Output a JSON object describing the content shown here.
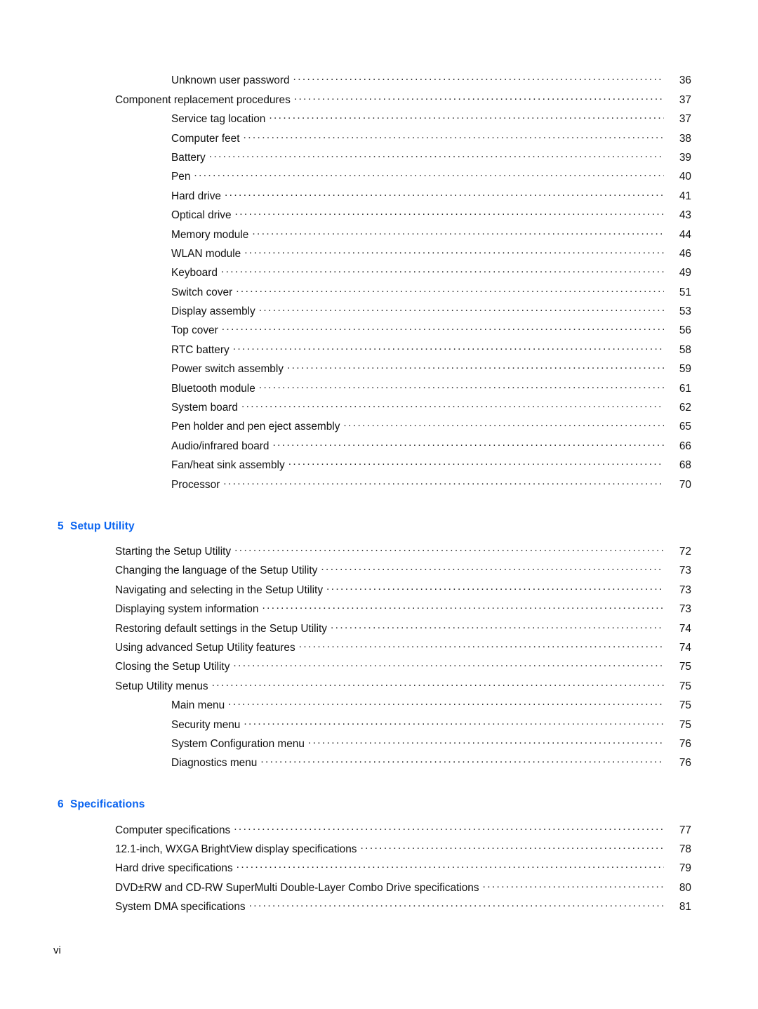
{
  "page": {
    "folio": "vi",
    "accent_color": "#0A64F0",
    "text_color": "#111111",
    "background_color": "#FFFFFF"
  },
  "toc": {
    "blocks": [
      {
        "chapter": null,
        "entries": [
          {
            "label": "Unknown user password",
            "page": "36",
            "level": 2
          },
          {
            "label": "Component replacement procedures",
            "page": "37",
            "level": 1
          },
          {
            "label": "Service tag location",
            "page": "37",
            "level": 2
          },
          {
            "label": "Computer feet",
            "page": "38",
            "level": 2
          },
          {
            "label": "Battery",
            "page": "39",
            "level": 2
          },
          {
            "label": "Pen",
            "page": "40",
            "level": 2
          },
          {
            "label": "Hard drive",
            "page": "41",
            "level": 2
          },
          {
            "label": "Optical drive",
            "page": "43",
            "level": 2
          },
          {
            "label": "Memory module",
            "page": "44",
            "level": 2
          },
          {
            "label": "WLAN module",
            "page": "46",
            "level": 2
          },
          {
            "label": "Keyboard",
            "page": "49",
            "level": 2
          },
          {
            "label": "Switch cover",
            "page": "51",
            "level": 2
          },
          {
            "label": "Display assembly",
            "page": "53",
            "level": 2
          },
          {
            "label": "Top cover",
            "page": "56",
            "level": 2
          },
          {
            "label": "RTC battery",
            "page": "58",
            "level": 2
          },
          {
            "label": "Power switch assembly",
            "page": "59",
            "level": 2
          },
          {
            "label": "Bluetooth module",
            "page": "61",
            "level": 2
          },
          {
            "label": "System board",
            "page": "62",
            "level": 2
          },
          {
            "label": "Pen holder and pen eject assembly",
            "page": "65",
            "level": 2
          },
          {
            "label": "Audio/infrared board",
            "page": "66",
            "level": 2
          },
          {
            "label": "Fan/heat sink assembly",
            "page": "68",
            "level": 2
          },
          {
            "label": "Processor",
            "page": "70",
            "level": 2
          }
        ]
      },
      {
        "chapter": {
          "number": "5",
          "title": "Setup Utility"
        },
        "entries": [
          {
            "label": "Starting the Setup Utility",
            "page": "72",
            "level": 1
          },
          {
            "label": "Changing the language of the Setup Utility",
            "page": "73",
            "level": 1
          },
          {
            "label": "Navigating and selecting in the Setup Utility",
            "page": "73",
            "level": 1
          },
          {
            "label": "Displaying system information",
            "page": "73",
            "level": 1
          },
          {
            "label": "Restoring default settings in the Setup Utility",
            "page": "74",
            "level": 1
          },
          {
            "label": "Using advanced Setup Utility features",
            "page": "74",
            "level": 1
          },
          {
            "label": "Closing the Setup Utility",
            "page": "75",
            "level": 1
          },
          {
            "label": "Setup Utility menus",
            "page": "75",
            "level": 1
          },
          {
            "label": "Main menu",
            "page": "75",
            "level": 2
          },
          {
            "label": "Security menu",
            "page": "75",
            "level": 2
          },
          {
            "label": "System Configuration menu",
            "page": "76",
            "level": 2
          },
          {
            "label": "Diagnostics menu",
            "page": "76",
            "level": 2
          }
        ]
      },
      {
        "chapter": {
          "number": "6",
          "title": "Specifications"
        },
        "entries": [
          {
            "label": "Computer specifications",
            "page": "77",
            "level": 1
          },
          {
            "label": "12.1-inch, WXGA BrightView display specifications",
            "page": "78",
            "level": 1
          },
          {
            "label": "Hard drive specifications",
            "page": "79",
            "level": 1
          },
          {
            "label": "DVD±RW and CD-RW SuperMulti Double-Layer Combo Drive specifications",
            "page": "80",
            "level": 1
          },
          {
            "label": "System DMA specifications",
            "page": "81",
            "level": 1
          }
        ]
      }
    ]
  }
}
